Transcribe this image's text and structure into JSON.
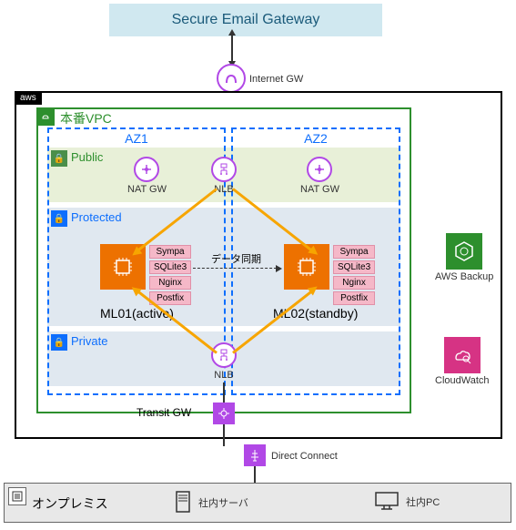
{
  "seg_label": "Secure Email Gateway",
  "cloud": {
    "provider": "aws",
    "vpc": "本番VPC"
  },
  "az": {
    "a": "AZ1",
    "b": "AZ2"
  },
  "subnet": {
    "public": "Public",
    "protected": "Protected",
    "private": "Private"
  },
  "gw": {
    "igw": "Internet GW",
    "nat": "NAT GW",
    "nlb": "NLB",
    "tgw": "Transit GW",
    "dx": "Direct Connect"
  },
  "instance": {
    "a": "ML01(active)",
    "b": "ML02(standby)"
  },
  "software": [
    "Sympa",
    "SQLite3",
    "Nginx",
    "Postfix"
  ],
  "sync_label": "データ同期",
  "services": {
    "backup": "AWS Backup",
    "cloudwatch": "CloudWatch"
  },
  "onprem": {
    "title": "オンプレミス",
    "server": "社内サーバ",
    "pc": "社内PC"
  }
}
